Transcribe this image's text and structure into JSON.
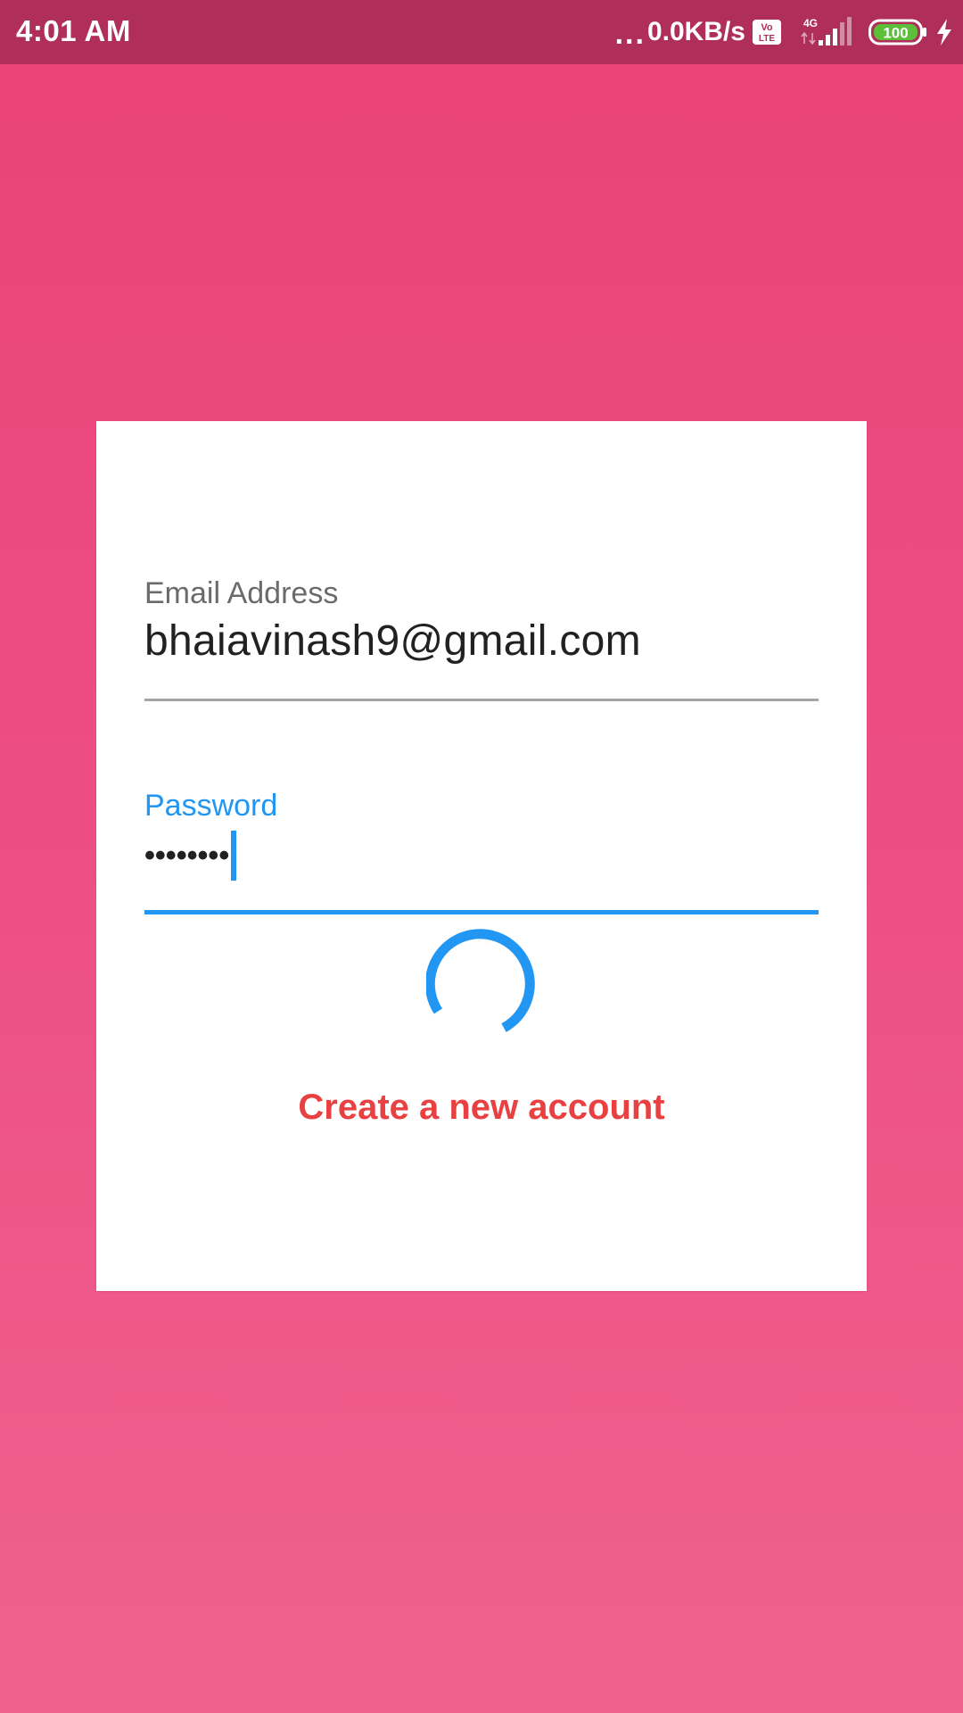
{
  "status_bar": {
    "time": "4:01 AM",
    "dots": "...",
    "network_speed": "0.0KB/s",
    "volte_icon": "volte-icon",
    "network_type": "4G",
    "signal_icon": "signal-icon",
    "battery_level": "100",
    "charging_icon": "charging-icon",
    "background_color": "#b02f5a"
  },
  "login_form": {
    "email": {
      "label": "Email Address",
      "value": "bhaiavinash9@gmail.com"
    },
    "password": {
      "label": "Password",
      "masked_value": "••••••••"
    },
    "loading_icon": "progress-spinner-icon",
    "create_account_label": "Create a new account"
  },
  "colors": {
    "background_top": "#ea4379",
    "background_bottom": "#f0618f",
    "accent": "#2196f3",
    "link": "#e94141",
    "card": "#ffffff"
  }
}
